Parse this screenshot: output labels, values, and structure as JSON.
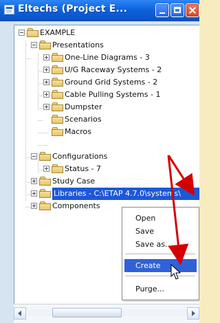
{
  "window": {
    "title": "Eltechs (Project E..."
  },
  "tree": {
    "items": [
      {
        "label": "EXAMPLE"
      },
      {
        "label": "Presentations"
      },
      {
        "label": "One-Line Diagrams - 3"
      },
      {
        "label": "U/G Raceway Systems - 2"
      },
      {
        "label": "Ground Grid Systems - 2"
      },
      {
        "label": "Cable Pulling Systems - 1"
      },
      {
        "label": "Dumpster"
      },
      {
        "label": "Scenarios"
      },
      {
        "label": "Macros"
      },
      {
        "label": "Configurations"
      },
      {
        "label": "Status - 7"
      },
      {
        "label": "Study Case"
      },
      {
        "label": "Libraries - C:\\ETAP 4.7.0\\systems\\"
      },
      {
        "label": "Components"
      }
    ]
  },
  "context_menu": {
    "items": [
      {
        "label": "Open"
      },
      {
        "label": "Save"
      },
      {
        "label": "Save as..."
      },
      {
        "label": "Create"
      },
      {
        "label": "Purge..."
      }
    ]
  },
  "colors": {
    "annotation_arrow": "#d40000",
    "selection": "#1d58d8",
    "menu_highlight": "#2f62d9"
  }
}
